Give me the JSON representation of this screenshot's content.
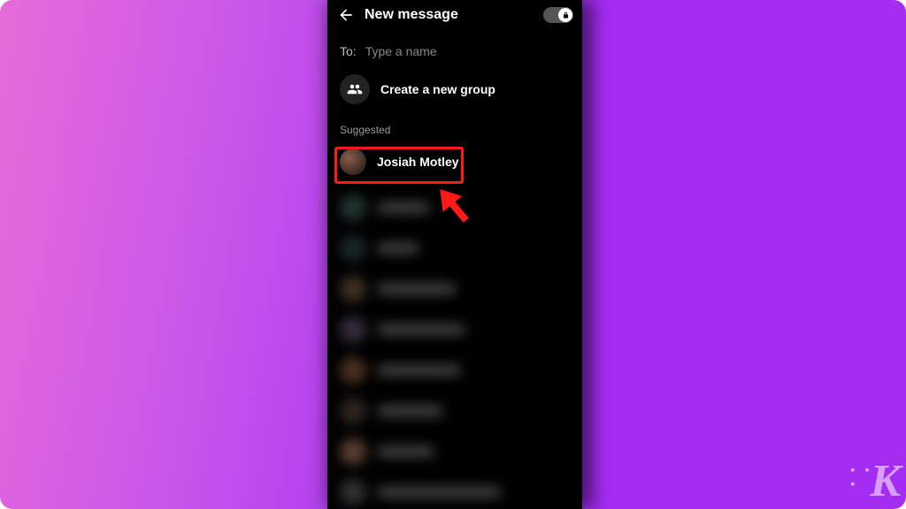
{
  "header": {
    "title": "New message",
    "toggle_on": true
  },
  "to": {
    "label": "To:",
    "placeholder": "Type a name",
    "value": ""
  },
  "create_group": {
    "label": "Create a new group"
  },
  "suggested_label": "Suggested",
  "suggested": [
    {
      "name": "Josiah Motley"
    }
  ],
  "annotation": {
    "highlight_target": "Josiah Motley"
  },
  "watermark": "K"
}
